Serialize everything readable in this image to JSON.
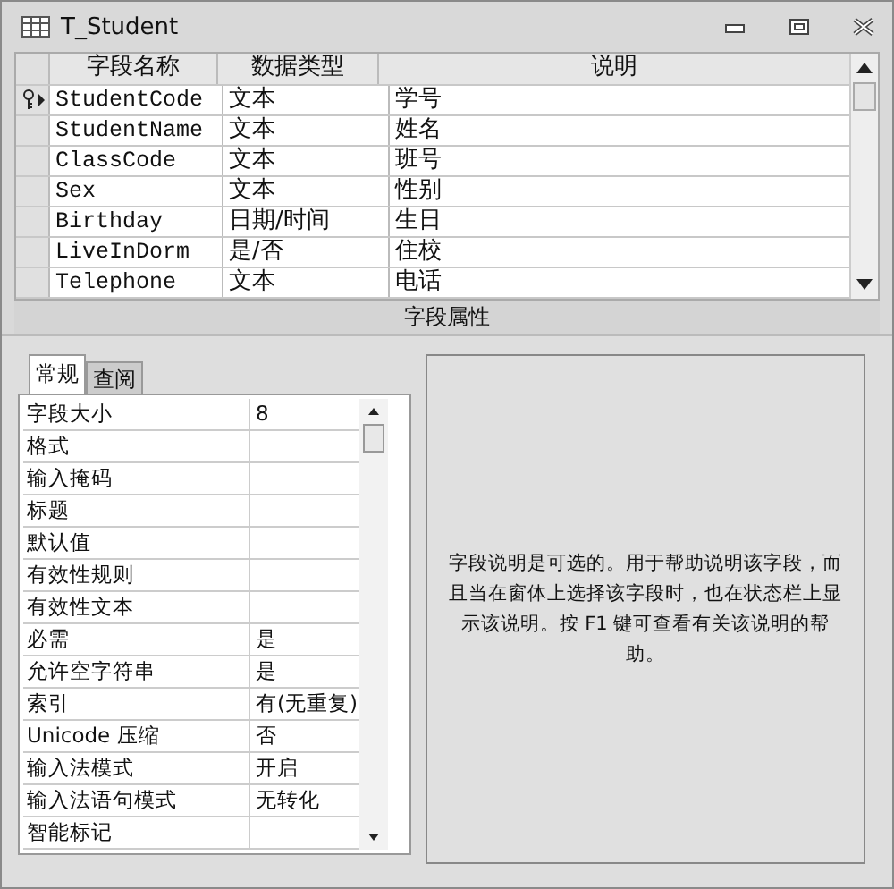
{
  "window": {
    "title": "T_Student"
  },
  "grid": {
    "columns": [
      "字段名称",
      "数据类型",
      "说明"
    ],
    "rows": [
      {
        "name": "StudentCode",
        "type": "文本",
        "description": "学号",
        "primary_key": true,
        "current": true
      },
      {
        "name": "StudentName",
        "type": "文本",
        "description": "姓名",
        "primary_key": false,
        "current": false
      },
      {
        "name": "ClassCode",
        "type": "文本",
        "description": "班号",
        "primary_key": false,
        "current": false
      },
      {
        "name": "Sex",
        "type": "文本",
        "description": "性别",
        "primary_key": false,
        "current": false
      },
      {
        "name": "Birthday",
        "type": "日期/时间",
        "description": "生日",
        "primary_key": false,
        "current": false
      },
      {
        "name": "LiveInDorm",
        "type": "是/否",
        "description": "住校",
        "primary_key": false,
        "current": false
      },
      {
        "name": "Telephone",
        "type": "文本",
        "description": "电话",
        "primary_key": false,
        "current": false
      }
    ]
  },
  "properties_bar": "字段属性",
  "tabs": [
    {
      "label": "常规",
      "selected": true
    },
    {
      "label": "查阅",
      "selected": false
    }
  ],
  "properties": [
    {
      "name": "字段大小",
      "value": "8"
    },
    {
      "name": "格式"
    },
    {
      "name": "输入掩码"
    },
    {
      "name": "标题"
    },
    {
      "name": "默认值"
    },
    {
      "name": "有效性规则"
    },
    {
      "name": "有效性文本"
    },
    {
      "name": "必需",
      "value": "是"
    },
    {
      "name": "允许空字符串",
      "value": "是"
    },
    {
      "name": "索引",
      "value": "有(无重复)"
    },
    {
      "name": "Unicode 压缩",
      "value": "否"
    },
    {
      "name": "输入法模式",
      "value": "开启"
    },
    {
      "name": "输入法语句模式",
      "value": "无转化"
    },
    {
      "name": "智能标记"
    }
  ],
  "help_text": "字段说明是可选的。用于帮助说明该字段，而且当在窗体上选择该字段时，也在状态栏上显示该说明。按 F1 键可查看有关该说明的帮助。"
}
